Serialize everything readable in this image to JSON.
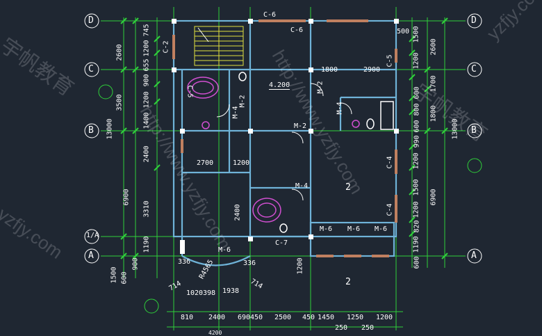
{
  "colors": {
    "background": "#1f2732",
    "axis_line": "#2fd13a",
    "wall": "#6fb3d8",
    "door_window": "#c08060",
    "fixture": "#d14fd1",
    "text": "#ffffff",
    "dim_text": "#ffffff"
  },
  "axes_left": [
    "D",
    "C",
    "B",
    "1/A",
    "A"
  ],
  "axes_right": [
    "D",
    "C",
    "B",
    "A"
  ],
  "left_dims_outer": [
    "2600",
    "3500",
    "13000",
    "6900",
    "1500"
  ],
  "left_dims_inner": [
    "745",
    "1200",
    "655",
    "900",
    "1200",
    "1400",
    "2400",
    "3310",
    "1190",
    "900",
    "600"
  ],
  "right_dims_outer": [
    "2600",
    "1700",
    "1800",
    "13000",
    "6900"
  ],
  "right_dims_inner": [
    "1500",
    "1200",
    "600",
    "800",
    "600",
    "990",
    "1200",
    "1500",
    "1200",
    "820",
    "1190",
    "600"
  ],
  "bottom_dims": [
    "810",
    "2400",
    "690",
    "450",
    "2500",
    "450",
    "1450",
    "1250",
    "1200",
    "250",
    "250"
  ],
  "bottom_total": "4200",
  "curve_dims": [
    "714",
    "1020",
    "398",
    "1938",
    "714",
    "336",
    "336",
    "R4565"
  ],
  "interior_dims": [
    "1800",
    "2900",
    "2700",
    "1200",
    "2400",
    "1200",
    "500",
    "C-5"
  ],
  "labels": {
    "c6_top": "C-6",
    "c6_inner": "C-6",
    "c2": "C-2",
    "c5_bath": "C-5",
    "c5_right": "C-5",
    "elevation": "4.200",
    "m2_a": "M-2",
    "m2_b": "M-2",
    "m2_c": "M-2",
    "m4_a": "M-4",
    "m4_b": "M-4",
    "m4_c": "M-4",
    "c4_a": "C-4",
    "c4_b": "C-4",
    "m6_a": "M-6",
    "m6_b": "M-6",
    "m6_c": "M-6",
    "m6_d": "M-6",
    "c7": "C-7",
    "section_2a": "2",
    "section_2b": "2"
  },
  "watermarks": [
    "http://www.yzfjy.com",
    "宇帆教育",
    "宇帆教育",
    "http://www.yzfjy.com",
    "yzfjy.com",
    "yzfjy.com"
  ]
}
